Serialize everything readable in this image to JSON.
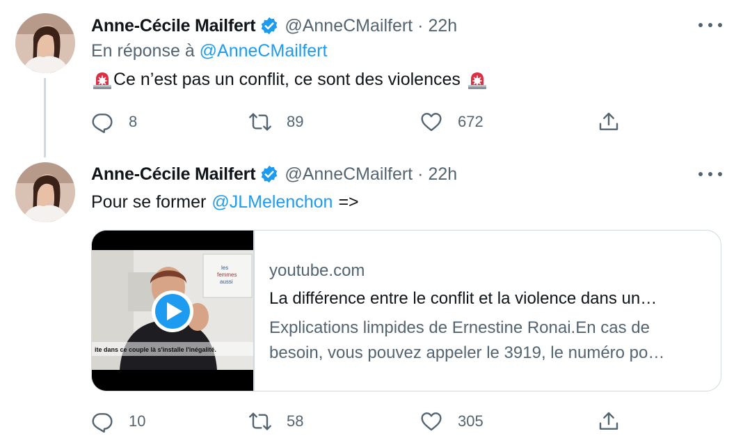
{
  "tweets": [
    {
      "author_name": "Anne-Cécile Mailfert",
      "handle": "@AnneCMailfert",
      "separator": "·",
      "time": "22h",
      "reply_prefix": "En réponse à",
      "reply_mention": "@AnneCMailfert",
      "text": "Ce n’est pas un conflit, ce sont des violences",
      "counts": {
        "replies": "8",
        "retweets": "89",
        "likes": "672"
      }
    },
    {
      "author_name": "Anne-Cécile Mailfert",
      "handle": "@AnneCMailfert",
      "separator": "·",
      "time": "22h",
      "text_before": "Pour se former",
      "mention": "@JLMelenchon",
      "text_after": "=>",
      "card": {
        "domain": "youtube.com",
        "title": "La différence entre le conflit et la violence dans un…",
        "description_line1": "Explications limpides de Ernestine Ronai.En cas de",
        "description_line2": "besoin, vous pouvez appeler le 3919, le numéro po…",
        "subtitle": "ite dans ce couple là s'installe l'inégalité.",
        "poster_text_1": "les",
        "poster_text_2": "femmes",
        "poster_text_3": "aussi"
      },
      "counts": {
        "replies": "10",
        "retweets": "58",
        "likes": "305"
      }
    }
  ],
  "icons": {
    "reply": "reply-icon",
    "retweet": "retweet-icon",
    "like": "heart-icon",
    "share": "share-icon",
    "verified": "verified-badge-icon",
    "more": "more-icon",
    "siren": "police-siren-emoji",
    "play": "play-icon"
  },
  "colors": {
    "link": "#1d9bf0",
    "secondary_text": "#536471",
    "primary_text": "#0f1419",
    "border": "#cfd9de"
  }
}
